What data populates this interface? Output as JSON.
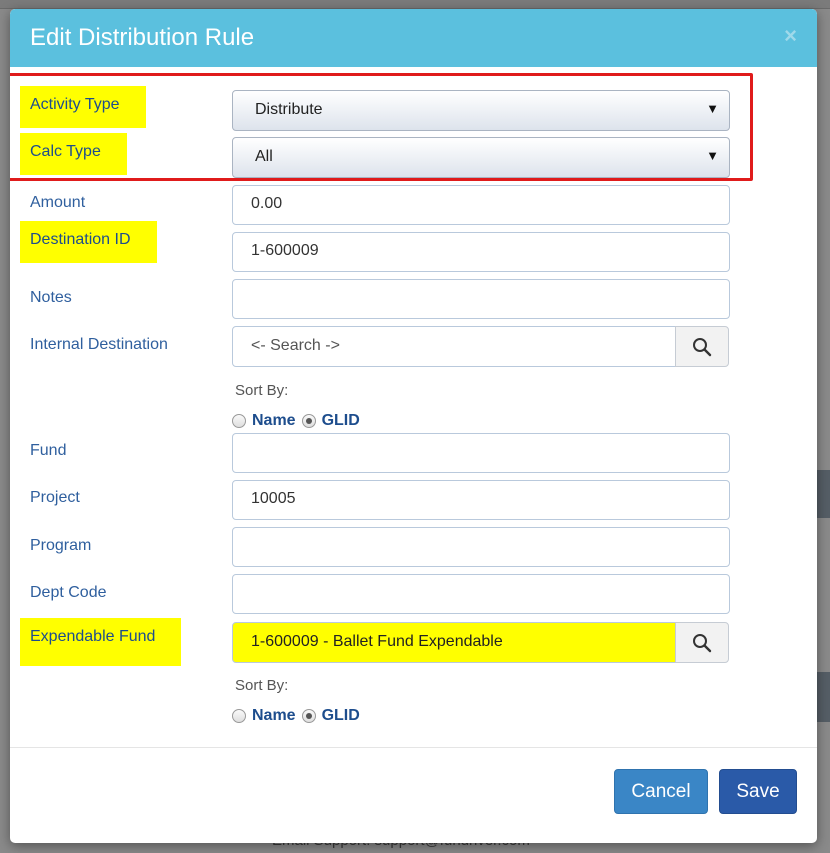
{
  "modal": {
    "title": "Edit Distribution Rule",
    "close_glyph": "×"
  },
  "fields": {
    "activity_type": {
      "label": "Activity Type",
      "value": "Distribute"
    },
    "calc_type": {
      "label": "Calc Type",
      "value": "All"
    },
    "amount": {
      "label": "Amount",
      "value": "0.00"
    },
    "destination_id": {
      "label": "Destination ID",
      "value": "1-600009"
    },
    "notes": {
      "label": "Notes",
      "value": ""
    },
    "internal_destination": {
      "label": "Internal Destination",
      "placeholder": "<- Search ->",
      "sort_by_label": "Sort By:",
      "sort_options": [
        "Name",
        "GLID"
      ],
      "sort_selected": "GLID"
    },
    "fund": {
      "label": "Fund",
      "value": ""
    },
    "project": {
      "label": "Project",
      "value": "10005"
    },
    "program": {
      "label": "Program",
      "value": ""
    },
    "dept_code": {
      "label": "Dept Code",
      "value": ""
    },
    "expendable_fund": {
      "label": "Expendable Fund",
      "value": "1-600009 - Ballet Fund Expendable",
      "sort_by_label": "Sort By:",
      "sort_options": [
        "Name",
        "GLID"
      ],
      "sort_selected": "GLID"
    }
  },
  "footer": {
    "cancel_label": "Cancel",
    "save_label": "Save"
  },
  "backdrop": {
    "footer_text": "Email Support: support@fundriver.com"
  },
  "colors": {
    "header": "#5bc0de",
    "highlight": "#ffff00",
    "annotation_box": "#e01b1b",
    "cancel_button": "#3a86c6",
    "save_button": "#2a5aa8"
  },
  "icons": {
    "search": "search-icon",
    "dropdown": "caret-down-icon",
    "close": "close-icon"
  }
}
